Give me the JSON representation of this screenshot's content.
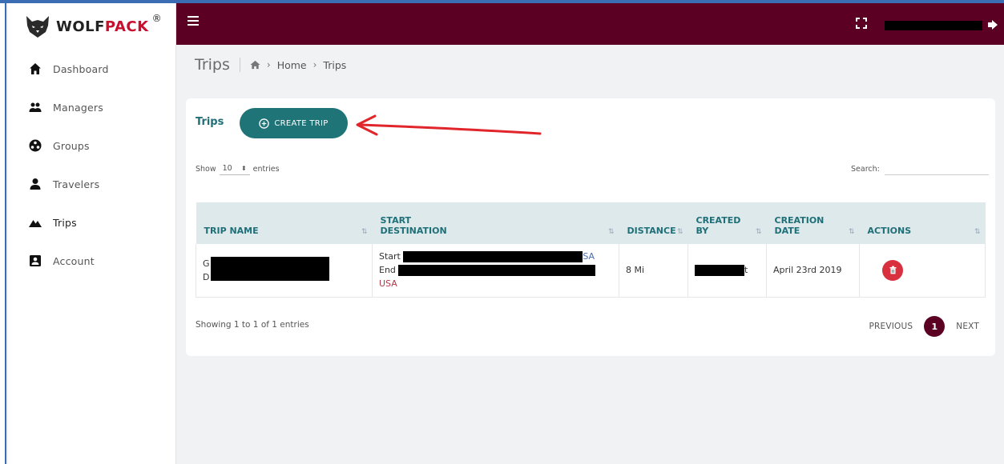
{
  "brand": {
    "name_part1": "WOLF",
    "name_part2": "PACK",
    "reg": "®"
  },
  "sidebar": {
    "items": [
      {
        "label": "Dashboard",
        "icon": "home-icon"
      },
      {
        "label": "Managers",
        "icon": "users-icon"
      },
      {
        "label": "Groups",
        "icon": "groups-icon"
      },
      {
        "label": "Travelers",
        "icon": "user-icon"
      },
      {
        "label": "Trips",
        "icon": "mountain-icon"
      },
      {
        "label": "Account",
        "icon": "account-icon"
      }
    ]
  },
  "header": {
    "user_name": ""
  },
  "breadcrumb": {
    "title": "Trips",
    "home": "Home",
    "current": "Trips"
  },
  "card": {
    "title": "Trips",
    "create_label": "CREATE TRIP",
    "show_label": "Show",
    "entries_value": "10",
    "entries_label": "entries",
    "search_label": "Search:",
    "search_value": ""
  },
  "table": {
    "headers": {
      "trip_name": "TRIP NAME",
      "start_destination_1": "START",
      "start_destination_2": "DESTINATION",
      "distance": "DISTANCE",
      "created_by_1": "CREATED",
      "created_by_2": "BY",
      "creation_date_1": "CREATION",
      "creation_date_2": "DATE",
      "actions": "ACTIONS"
    },
    "rows": [
      {
        "trip_name_1": "G",
        "trip_name_2": "D",
        "start": "Start",
        "start_suffix": "SA",
        "end": "End",
        "country": "USA",
        "distance": "8 Mi",
        "created_by_suffix": "t",
        "creation_date": "April 23rd 2019"
      }
    ]
  },
  "footer": {
    "showing": "Showing 1 to 1 of 1 entries",
    "previous": "PREVIOUS",
    "page": "1",
    "next": "NEXT"
  },
  "colors": {
    "topbar": "#5b0022",
    "accent": "#1f7478",
    "danger": "#d8303f",
    "arrow": "#e0262b"
  }
}
